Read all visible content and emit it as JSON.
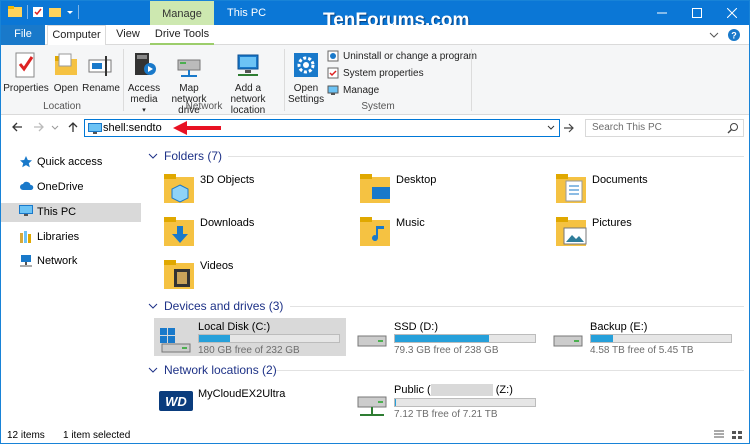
{
  "window": {
    "title": "This PC",
    "watermark": "TenForums.com",
    "context_tab": "Manage"
  },
  "tabs": {
    "file": "File",
    "computer": "Computer",
    "view": "View",
    "drive_tools": "Drive Tools"
  },
  "ribbon": {
    "properties": "Properties",
    "open": "Open",
    "rename": "Rename",
    "access_media": "Access media",
    "map_network_drive": "Map network drive",
    "add_network_location": "Add a network location",
    "open_settings": "Open Settings",
    "uninstall": "Uninstall or change a program",
    "system_properties": "System properties",
    "manage": "Manage",
    "group_location": "Location",
    "group_network": "Network",
    "group_system": "System"
  },
  "address": {
    "value": "shell:sendto",
    "search_placeholder": "Search This PC"
  },
  "nav": [
    {
      "label": "Quick access",
      "icon": "star-icon"
    },
    {
      "label": "OneDrive",
      "icon": "cloud-icon"
    },
    {
      "label": "This PC",
      "icon": "computer-icon",
      "selected": true
    },
    {
      "label": "Libraries",
      "icon": "libraries-icon"
    },
    {
      "label": "Network",
      "icon": "network-icon"
    }
  ],
  "sections": {
    "folders": "Folders (7)",
    "devices": "Devices and drives (3)",
    "network": "Network locations (2)"
  },
  "folders": [
    "3D Objects",
    "Desktop",
    "Documents",
    "Downloads",
    "Music",
    "Pictures",
    "Videos"
  ],
  "drives": [
    {
      "name": "Local Disk (C:)",
      "free": "180 GB free of 232 GB",
      "used_fraction": 0.22,
      "selected": true
    },
    {
      "name": "SSD (D:)",
      "free": "79.3 GB free of 238 GB",
      "used_fraction": 0.67
    },
    {
      "name": "Backup (E:)",
      "free": "4.58 TB free of 5.45 TB",
      "used_fraction": 0.16
    }
  ],
  "network_locations": [
    {
      "name": "MyCloudEX2Ultra"
    },
    {
      "name_prefix": "Public (",
      "name_suffix": "(Z:)",
      "free": "7.12 TB free of 7.21 TB",
      "used_fraction": 0.01
    }
  ],
  "status": {
    "items": "12 items",
    "selected": "1 item selected"
  },
  "colors": {
    "accent": "#0b77d6",
    "bar": "#26a0da",
    "manage_tab": "#cde8b0",
    "arrow": "#e81123"
  }
}
